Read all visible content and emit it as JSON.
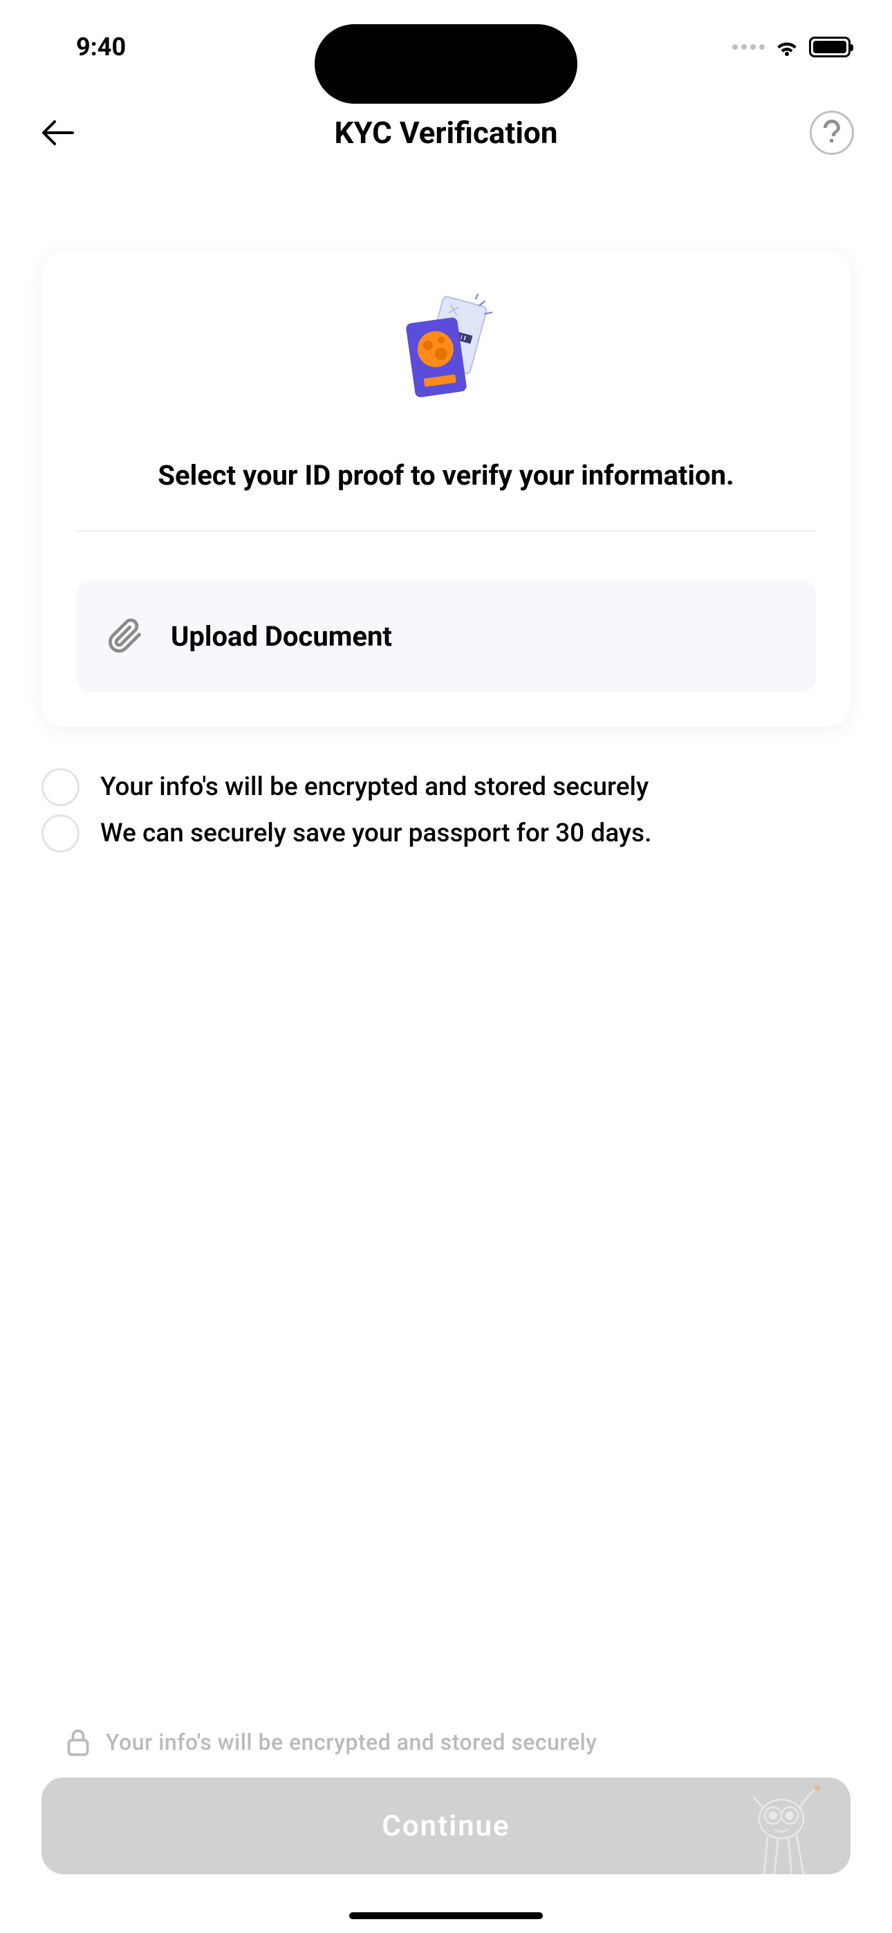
{
  "status_bar": {
    "time": "9:40"
  },
  "nav": {
    "title": "KYC Verification"
  },
  "card": {
    "title": "Select your ID proof to verify your information.",
    "upload_label": "Upload Document"
  },
  "info_items": [
    "Your info's will be encrypted and stored securely",
    "We can securely save your passport for 30 days."
  ],
  "footer": {
    "security_note": "Your info's will be encrypted and stored securely",
    "continue_label": "Continue"
  }
}
